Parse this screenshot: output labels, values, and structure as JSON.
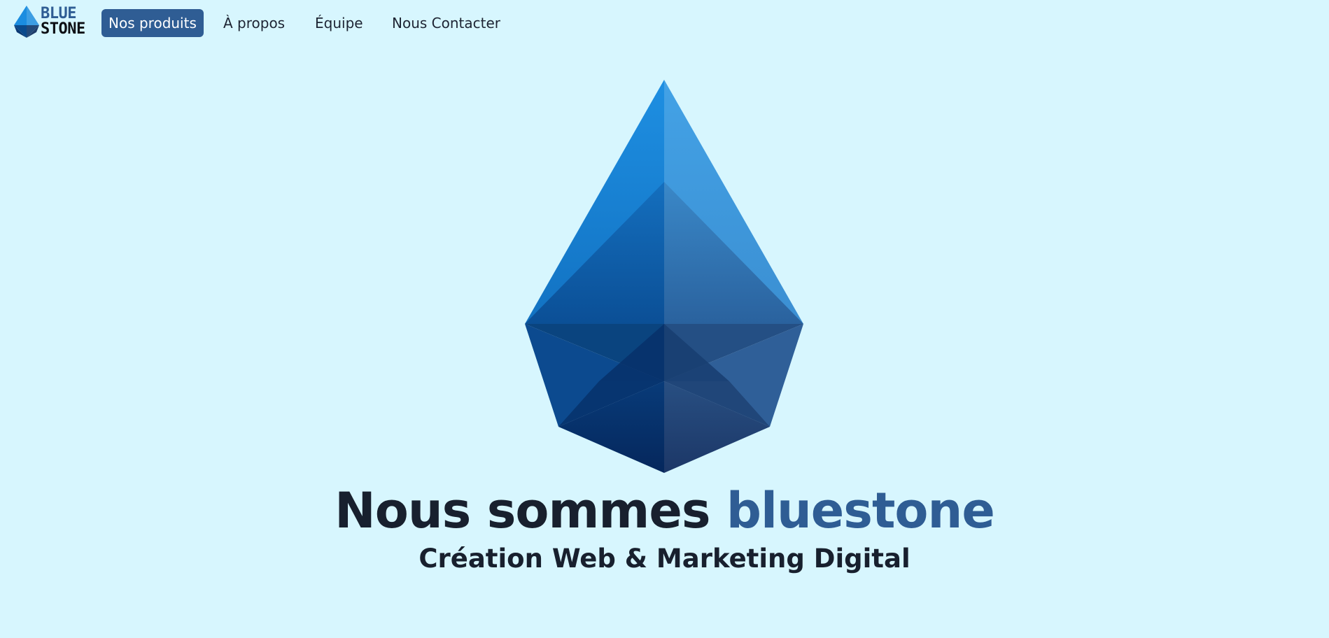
{
  "brand": {
    "line1": "BLUE",
    "line2": "STONE",
    "icon": "gem-logo-icon",
    "colors": {
      "accent": "#2f5d94",
      "dark": "#0d0f14"
    }
  },
  "nav": {
    "items": [
      {
        "label": "Nos produits",
        "active": true
      },
      {
        "label": "À propos",
        "active": false
      },
      {
        "label": "Équipe",
        "active": false
      },
      {
        "label": "Nous Contacter",
        "active": false
      }
    ]
  },
  "hero": {
    "image_icon": "blue-gem-icon",
    "title_main": "Nous sommes ",
    "title_accent": "bluestone",
    "subtitle": "Création Web & Marketing Digital"
  },
  "colors": {
    "background": "#d7f6fe",
    "accent": "#2f5d94",
    "text": "#18202e"
  }
}
